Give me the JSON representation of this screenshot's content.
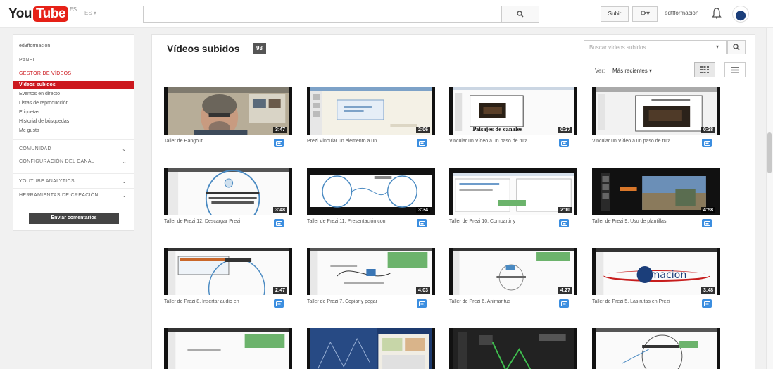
{
  "header": {
    "logo_you": "You",
    "logo_tube": "Tube",
    "logo_country": "ES",
    "country_menu": "ES ▾",
    "search_placeholder": "",
    "upload_label": "Subir",
    "account_name": "edtfformacion"
  },
  "sidebar": {
    "channel": "ed3fformacion",
    "panel": "PANEL",
    "manager": "GESTOR DE VÍDEOS",
    "items": [
      "Vídeos subidos",
      "Eventos en directo",
      "Listas de reproducción",
      "Etiquetas",
      "Historial de búsquedas",
      "Me gusta"
    ],
    "sections": [
      "COMUNIDAD",
      "CONFIGURACIÓN DEL CANAL",
      "YOUTUBE ANALYTICS",
      "HERRAMIENTAS DE CREACIÓN"
    ],
    "feedback_label": "Enviar comentarios"
  },
  "main": {
    "title": "Vídeos subidos",
    "count": "93",
    "search_placeholder": "Buscar vídeos subidos",
    "sort_label": "Ver:",
    "sort_value": "Más recientes ▾"
  },
  "videos": [
    {
      "title": "Taller de Hangout",
      "duration": "3:47"
    },
    {
      "title": "Prezi Vincular un elemento a un",
      "duration": "2:06"
    },
    {
      "title": "Vincular un Vídeo a un paso de ruta",
      "duration": "0:37"
    },
    {
      "title": "Vincular un Vídeo a un paso de ruta",
      "duration": "0:38"
    },
    {
      "title": "Taller de Prezi 12. Descargar Prezi",
      "duration": "3:48"
    },
    {
      "title": "Taller de Prezi 11. Presentación con",
      "duration": "3:34"
    },
    {
      "title": "Taller de Prezi 10. Compartir y",
      "duration": "2:10"
    },
    {
      "title": "Taller de Prezi 9. Uso de plantillas",
      "duration": "4:58"
    },
    {
      "title": "Taller de Prezi 8. Insertar audio en",
      "duration": "2:47"
    },
    {
      "title": "Taller de Prezi 7. Copiar y pegar",
      "duration": "4:03"
    },
    {
      "title": "Taller de Prezi 6. Animar tus",
      "duration": "4:27"
    },
    {
      "title": "Taller de Prezi 5. Las rutas en Prezi",
      "duration": "3:48"
    },
    {
      "title": "",
      "duration": ""
    },
    {
      "title": "",
      "duration": ""
    },
    {
      "title": "",
      "duration": ""
    },
    {
      "title": "",
      "duration": ""
    }
  ],
  "thumb_texts": {
    "v3_caption": "Paisajes de canales",
    "v12_logo": "Formacion"
  },
  "colors": {
    "accent": "#cc181e",
    "link_icon": "#3b8ee0"
  }
}
